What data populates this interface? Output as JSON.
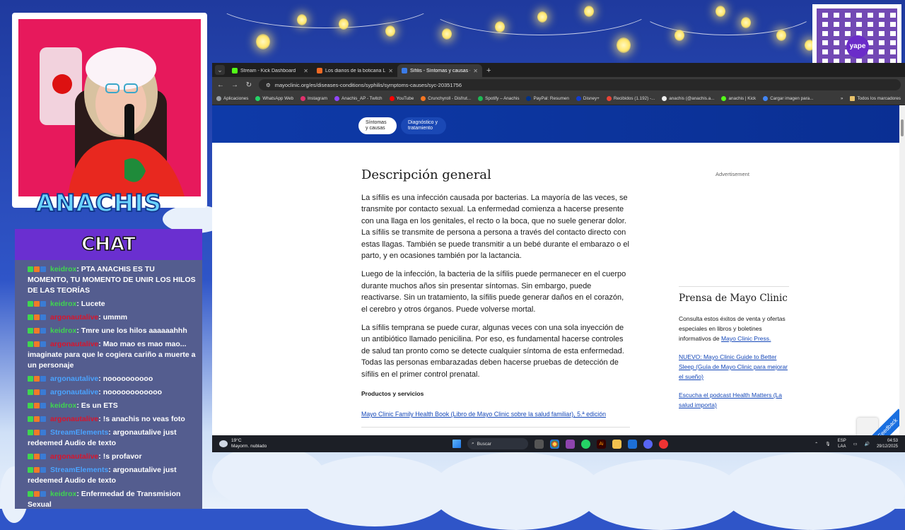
{
  "overlay": {
    "streamer_name": "ANACHIS",
    "chat_title": "CHAT",
    "qr_logo_text": "yape"
  },
  "chat": {
    "messages": [
      {
        "user": "keidrox",
        "user_color": "green",
        "text": ": PTA ANACHIS ES TU MOMENTO, TU MOMENTO DE UNIR LOS HILOS DE LAS TEORÍAS"
      },
      {
        "user": "keidrox",
        "user_color": "green",
        "text": ": Lucete"
      },
      {
        "user": "argonautalive",
        "user_color": "red",
        "text": ": ummm"
      },
      {
        "user": "keidrox",
        "user_color": "green",
        "text": ": Tmre une los hilos aaaaaahhh"
      },
      {
        "user": "argonautalive",
        "user_color": "red",
        "text": ": Mao mao es mao mao... imaginate para que le cogiera cariño a muerte a un personaje"
      },
      {
        "user": "argonautalive",
        "user_color": "blue",
        "text": ": noooooooooo"
      },
      {
        "user": "argonautalive",
        "user_color": "blue",
        "text": ": noooooooooooo"
      },
      {
        "user": "keidrox",
        "user_color": "green",
        "text": ": Es un ETS"
      },
      {
        "user": "argonautalive",
        "user_color": "red",
        "text": ": !s anachis no veas foto"
      },
      {
        "user": "StreamElements",
        "user_color": "blue",
        "text": ": argonautalive just redeemed Audio de texto"
      },
      {
        "user": "argonautalive",
        "user_color": "red",
        "text": ": !s profavor"
      },
      {
        "user": "StreamElements",
        "user_color": "blue",
        "text": ": argonautalive just redeemed Audio de texto"
      },
      {
        "user": "keidrox",
        "user_color": "green",
        "text": ": Enfermedad de Transmision Sexual"
      }
    ]
  },
  "browser": {
    "tabs": [
      {
        "label": "Stream - Kick Dashboard",
        "color": "#53fc18",
        "active": false
      },
      {
        "label": "Los diarios de la boticaria Lakar",
        "color": "#f06a24",
        "active": false
      },
      {
        "label": "Sífilis - Síntomas y causas - Ma",
        "color": "#3b7be8",
        "active": true
      }
    ],
    "url": "mayoclinic.org/es/diseases-conditions/syphilis/symptoms-causes/syc-20351756",
    "bookmarks": [
      {
        "label": "Aplicaciones",
        "color": "#9aa0a6"
      },
      {
        "label": "WhatsApp Web",
        "color": "#25d366"
      },
      {
        "label": "Instagram",
        "color": "#e1306c"
      },
      {
        "label": "Anachis_AP - Twitch",
        "color": "#9146ff"
      },
      {
        "label": "YouTube",
        "color": "#ff0000"
      },
      {
        "label": "Crunchyroll - Disfrut...",
        "color": "#f47521"
      },
      {
        "label": "Spotify – Anachis",
        "color": "#1db954"
      },
      {
        "label": "PayPal: Resumen",
        "color": "#003087"
      },
      {
        "label": "Disney+",
        "color": "#113ccf"
      },
      {
        "label": "Recibidos (1.192) -...",
        "color": "#ea4335"
      },
      {
        "label": "anachis (@anachis.a...",
        "color": "#eeeeee"
      },
      {
        "label": "anachis | Kick",
        "color": "#53fc18"
      },
      {
        "label": "Cargar imagen para...",
        "color": "#4285f4"
      }
    ],
    "all_bookmarks": "Todos los marcadores"
  },
  "page": {
    "pill_1": "Síntomas y causas",
    "pill_2": "Diagnóstico y tratamiento",
    "heading": "Descripción general",
    "paragraphs": [
      "La sífilis es una infección causada por bacterias. La mayoría de las veces, se transmite por contacto sexual. La enfermedad comienza a hacerse presente con una llaga en los genitales, el recto o la boca, que no suele generar dolor. La sífilis se transmite de persona a persona a través del contacto directo con estas llagas. También se puede transmitir a un bebé durante el embarazo o el parto, y en ocasiones también por la lactancia.",
      "Luego de la infección, la bacteria de la sífilis puede permanecer en el cuerpo durante muchos años sin presentar síntomas. Sin embargo, puede reactivarse. Sin un tratamiento, la sífilis puede generar daños en el corazón, el cerebro y otros órganos. Puede volverse mortal.",
      "La sífilis temprana se puede curar, algunas veces con una sola inyección de un antibiótico llamado penicilina. Por eso, es fundamental hacerse controles de salud tan pronto como se detecte cualquier síntoma de esta enfermedad. Todas las personas embarazadas deben hacerse pruebas de detección de sífilis en el primer control prenatal."
    ],
    "products_title": "Productos y servicios",
    "products_link": "Mayo Clinic Family Health Book (Libro de Mayo Clinic sobre la salud familiar), 5.ª edición",
    "ad_label": "Advertisement",
    "press_title": "Prensa de Mayo Clinic",
    "press_intro": "Consulta estos éxitos de venta y ofertas especiales en libros y boletines informativos de",
    "press_intro_link": "Mayo Clinic Press.",
    "press_link_1": "NUEVO: Mayo Clinic Guide to Better Sleep (Guía de Mayo Clinic para mejorar el sueño)",
    "press_link_2": "Escucha el podcast Health Matters (La salud importa)",
    "feedback": "Feedback"
  },
  "taskbar": {
    "temp": "19°C",
    "weather": "Mayorm. nublado",
    "search": "Buscar",
    "lang_1": "ESP",
    "lang_2": "LAA",
    "time": "04:53",
    "date": "29/12/2025"
  }
}
